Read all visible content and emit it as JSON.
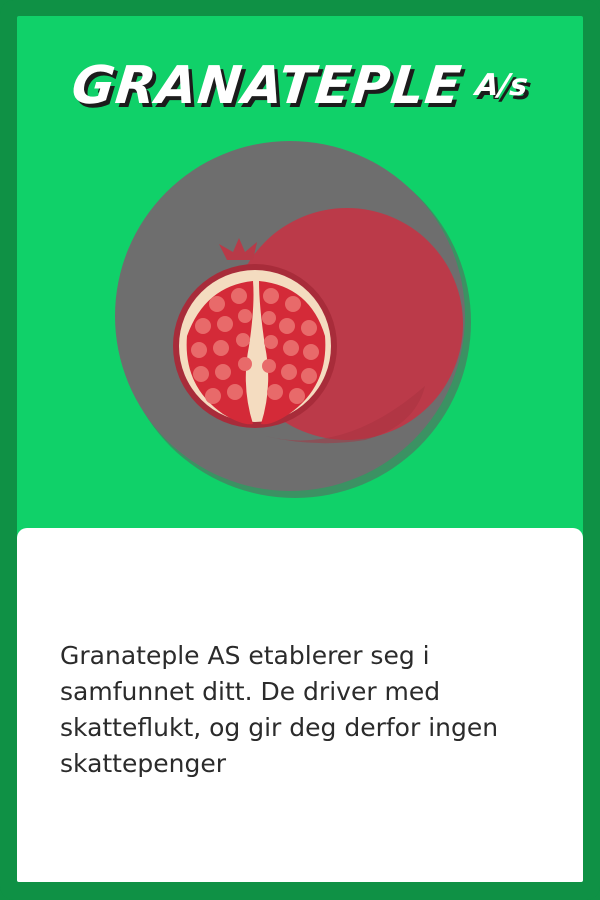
{
  "card": {
    "title": "GRANATEPLE",
    "title_suffix": "A/s",
    "illustration_icon": "pomegranate-icon",
    "description": "Granateple AS etablerer seg i samfunnet ditt. De driver med skatteflukt, og gir deg derfor ingen skattepenger"
  },
  "colors": {
    "frame": "#0f9145",
    "background": "#10d169",
    "circle": "#6e6e6e",
    "fruit": "#b83a48",
    "seeds": "#e36a6a",
    "text": "#2b2b2b"
  }
}
